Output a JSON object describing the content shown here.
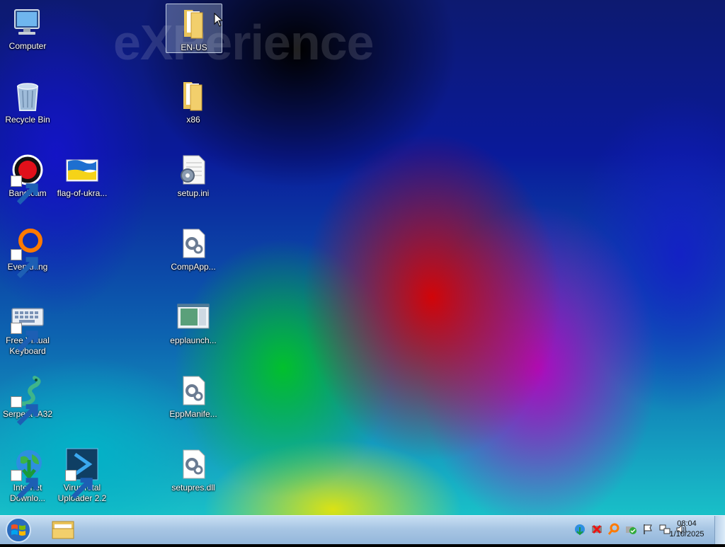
{
  "desktop": {
    "watermark": "eXPerience",
    "icons": [
      {
        "label": "Computer"
      },
      {
        "label": "Recycle Bin"
      },
      {
        "label": "Bandicam"
      },
      {
        "label": "flag-of-ukra..."
      },
      {
        "label": "Everything"
      },
      {
        "label": "Free Virtual Keyboard"
      },
      {
        "label": "Serpent IA32"
      },
      {
        "label": "Internet Downlo..."
      },
      {
        "label": "VirusTotal Uploader 2.2"
      },
      {
        "label": "EN-US"
      },
      {
        "label": "x86"
      },
      {
        "label": "setup.ini"
      },
      {
        "label": "CompApp..."
      },
      {
        "label": "epplaunch..."
      },
      {
        "label": "EppManife..."
      },
      {
        "label": "setupres.dll"
      }
    ]
  },
  "taskbar": {
    "clock": {
      "time": "08:04",
      "date": "1/10/2025"
    },
    "colors": {
      "folder": "#f2cf6c",
      "accent": "#1e7fd6"
    }
  }
}
